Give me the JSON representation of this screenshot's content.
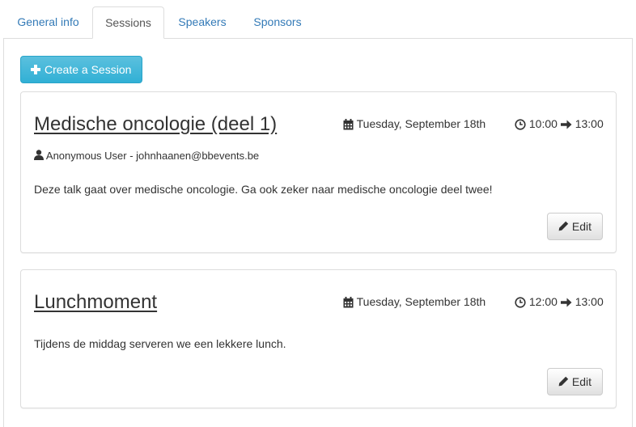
{
  "tabs": [
    {
      "label": "General info"
    },
    {
      "label": "Sessions"
    },
    {
      "label": "Speakers"
    },
    {
      "label": "Sponsors"
    }
  ],
  "active_tab": "Sessions",
  "toolbar": {
    "create_label": "Create a Session"
  },
  "sessions": [
    {
      "title": "Medische oncologie (deel 1)",
      "date": "Tuesday, September 18th",
      "start": "10:00",
      "end": "13:00",
      "author": "Anonymous User - johnhaanen@bbevents.be",
      "description": "Deze talk gaat over medische oncologie. Ga ook zeker naar medische oncologie deel twee!",
      "edit_label": "Edit"
    },
    {
      "title": "Lunchmoment",
      "date": "Tuesday, September 18th",
      "start": "12:00",
      "end": "13:00",
      "description": "Tijdens de middag serveren we een lekkere lunch.",
      "edit_label": "Edit"
    }
  ],
  "icons": {
    "create": "plus-icon",
    "author": "user-icon",
    "date": "calendar-icon",
    "time": "clock-icon",
    "range": "arrow-right-icon",
    "edit": "pencil-icon"
  },
  "colors": {
    "link": "#337ab7",
    "info_button": "#5bc0de",
    "border": "#dddddd"
  }
}
